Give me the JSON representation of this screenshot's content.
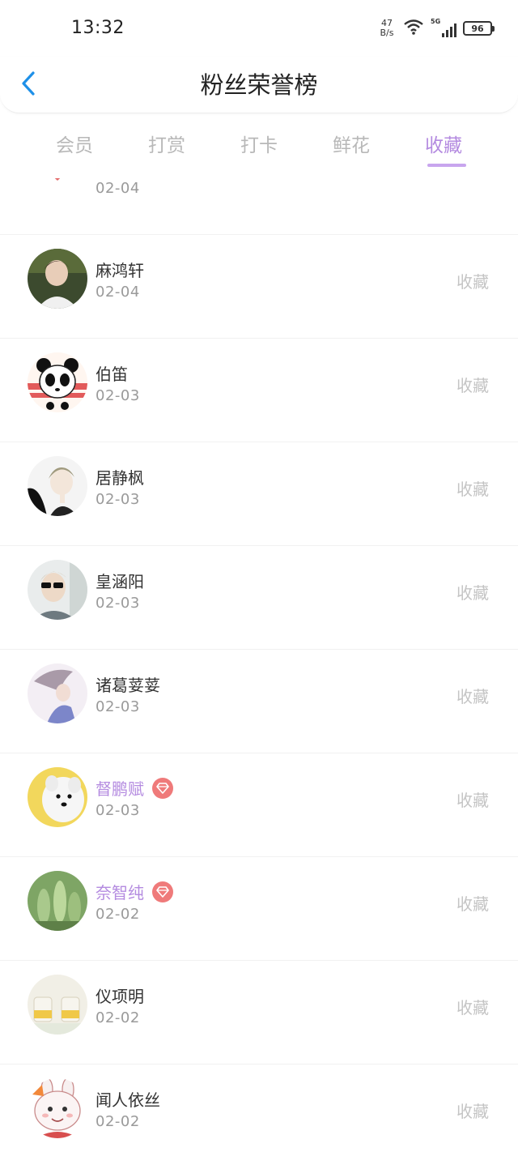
{
  "status_bar": {
    "time": "13:32",
    "net_speed_value": "47",
    "net_speed_unit": "B/s",
    "signal_label": "5G",
    "battery": "96"
  },
  "header": {
    "title": "粉丝荣誉榜"
  },
  "tabs": [
    {
      "label": "会员",
      "active": false
    },
    {
      "label": "打赏",
      "active": false
    },
    {
      "label": "打卡",
      "active": false
    },
    {
      "label": "鲜花",
      "active": false
    },
    {
      "label": "收藏",
      "active": true
    }
  ],
  "colors": {
    "accent": "#b48be0",
    "inactive_tab": "#b8b8b8",
    "vip_badge": "#ef7a7a",
    "back_arrow": "#1e90e8"
  },
  "list": {
    "partial_item": {
      "date": "02-04"
    },
    "items": [
      {
        "name": "麻鸿轩",
        "date": "02-04",
        "action": "收藏",
        "vip": false
      },
      {
        "name": "伯笛",
        "date": "02-03",
        "action": "收藏",
        "vip": false
      },
      {
        "name": "居静枫",
        "date": "02-03",
        "action": "收藏",
        "vip": false
      },
      {
        "name": "皇涵阳",
        "date": "02-03",
        "action": "收藏",
        "vip": false
      },
      {
        "name": "诸葛荽荽",
        "date": "02-03",
        "action": "收藏",
        "vip": false
      },
      {
        "name": "督鹏赋",
        "date": "02-03",
        "action": "收藏",
        "vip": true
      },
      {
        "name": "奈智纯",
        "date": "02-02",
        "action": "收藏",
        "vip": true
      },
      {
        "name": "仪项明",
        "date": "02-02",
        "action": "收藏",
        "vip": false
      },
      {
        "name": "闻人依丝",
        "date": "02-02",
        "action": "收藏",
        "vip": false
      }
    ]
  }
}
